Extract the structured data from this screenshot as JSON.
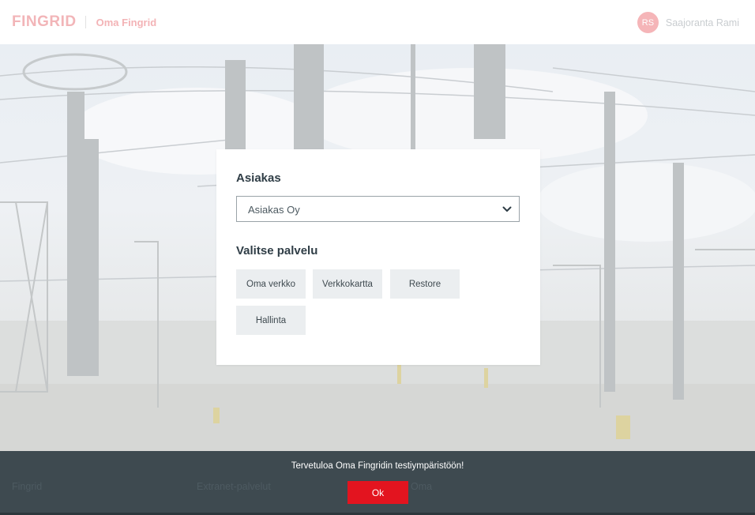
{
  "header": {
    "logo": "FINGRID",
    "app_name": "Oma Fingrid",
    "user_initials": "RS",
    "user_name": "Saajoranta Rami"
  },
  "card": {
    "customer_title": "Asiakas",
    "customer_selected": "Asiakas Oy",
    "service_title": "Valitse palvelu",
    "services": [
      "Oma verkko",
      "Verkkokartta",
      "Restore",
      "Hallinta"
    ]
  },
  "footer": {
    "links": [
      "Fingrid",
      "Extranet-palvelut",
      "Oma"
    ]
  },
  "notice": {
    "message": "Tervetuloa Oma Fingridin testiympäristöön!",
    "ok_label": "Ok"
  },
  "colors": {
    "brand_red": "#e3141f",
    "text_dark": "#2f3d46",
    "footer_bg": "#3e4a50",
    "button_bg": "#ebeef0"
  }
}
